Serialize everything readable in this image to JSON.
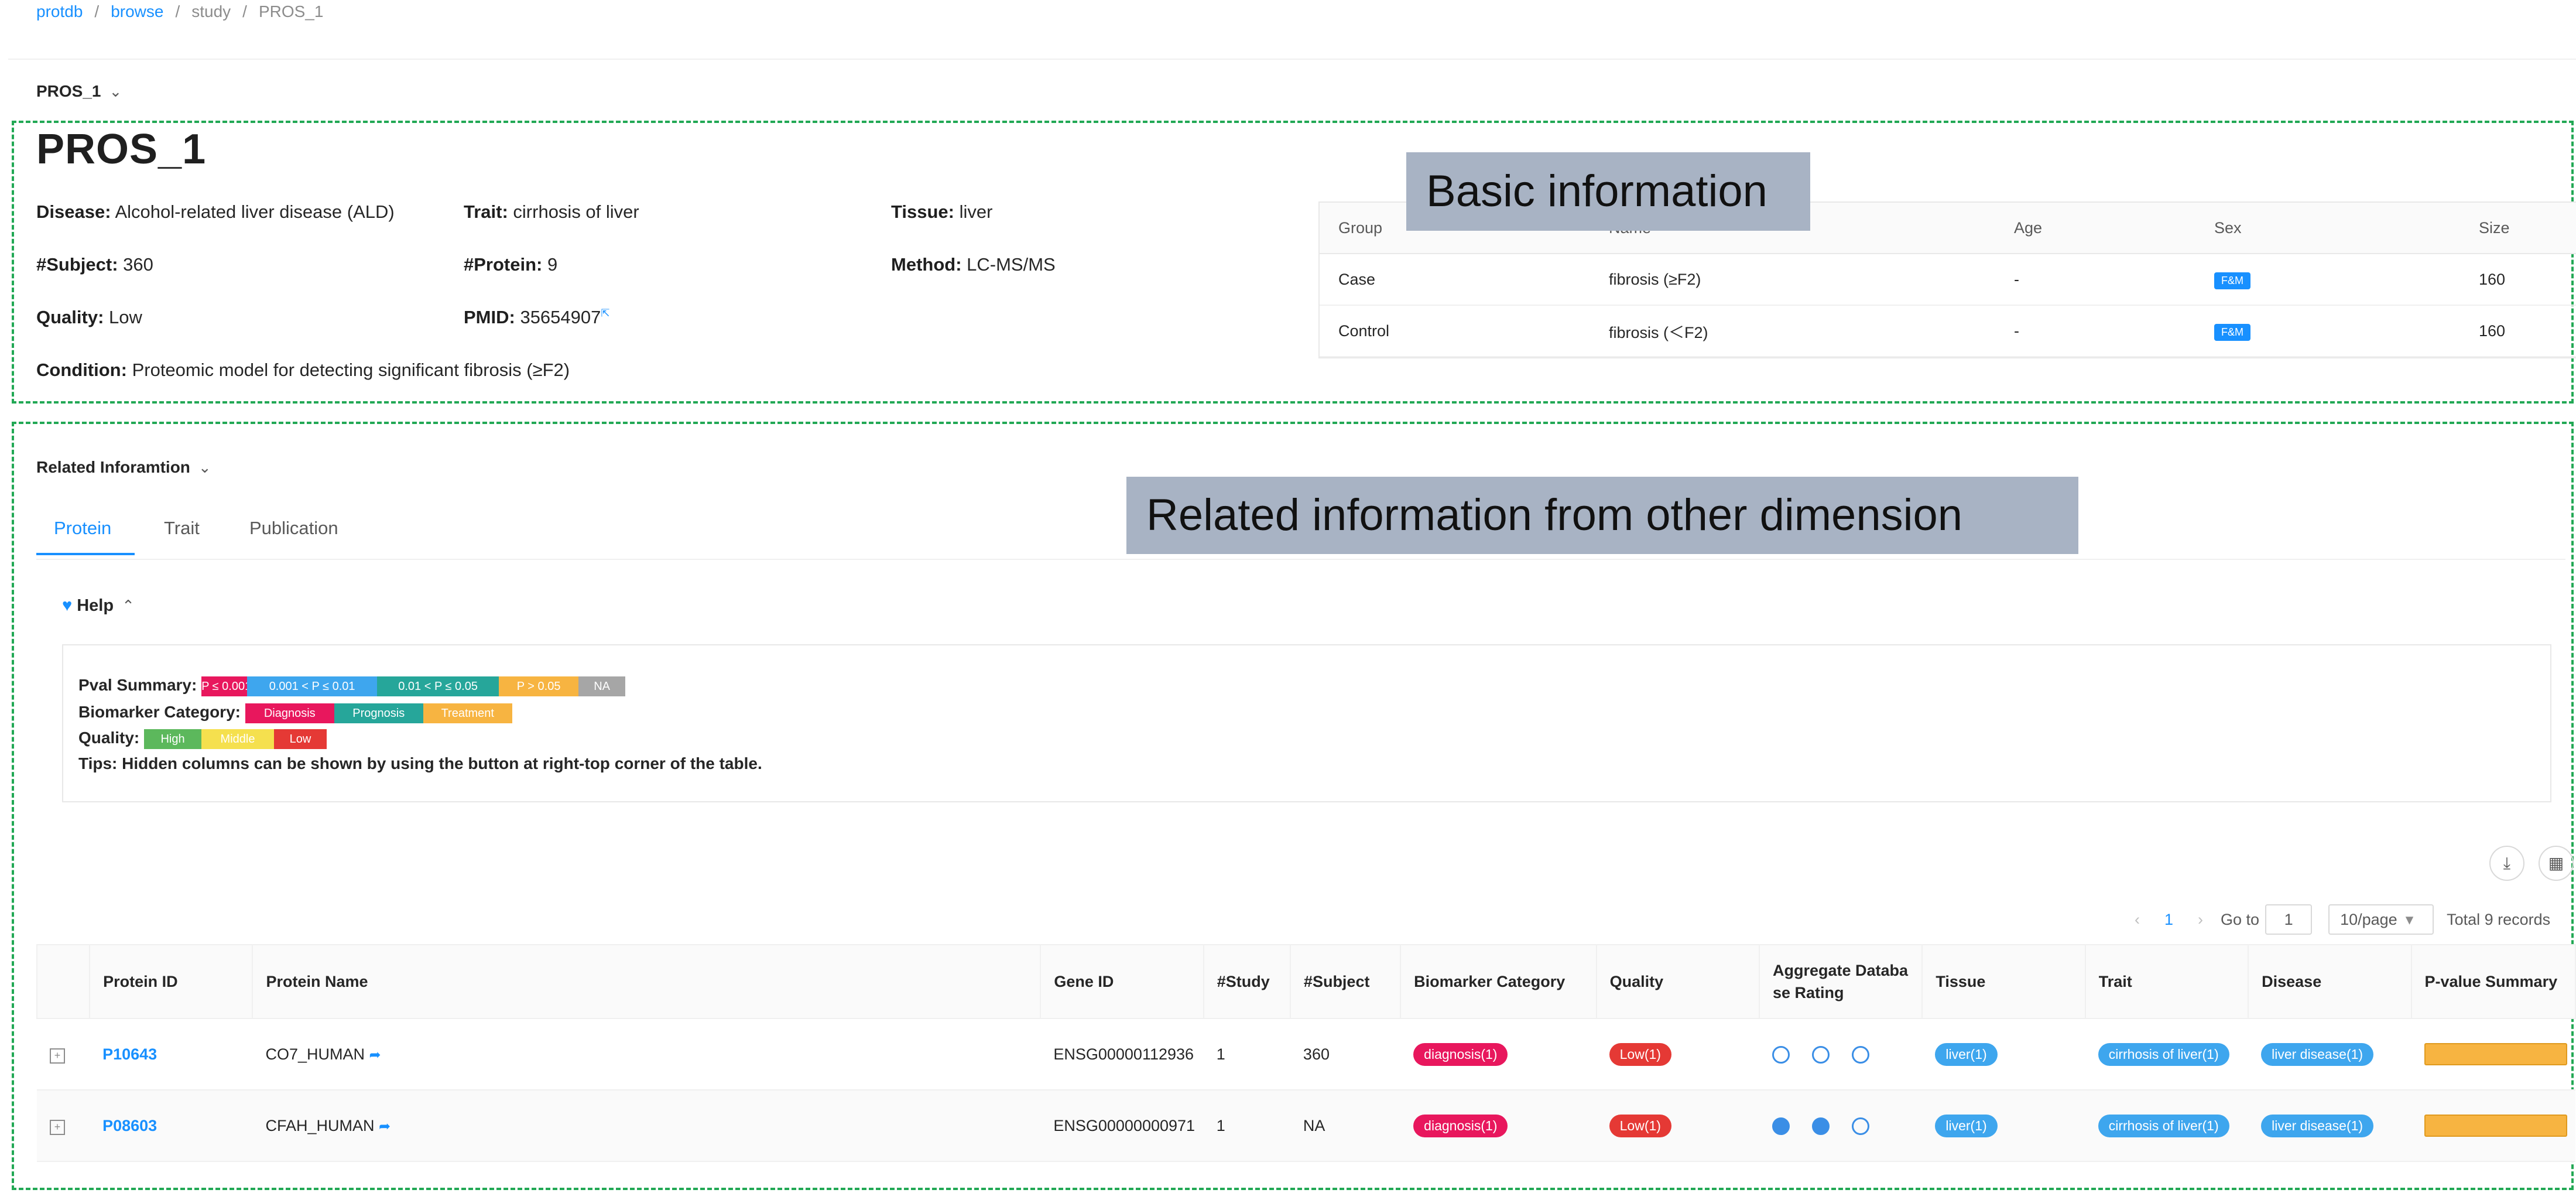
{
  "breadcrumb": [
    "protdb",
    "browse",
    "study",
    "PROS_1"
  ],
  "card_title": "PROS_1",
  "basic": {
    "title": "PROS_1",
    "disease_label": "Disease:",
    "disease": "Alcohol-related liver disease (ALD)",
    "trait_label": "Trait:",
    "trait": "cirrhosis of liver",
    "tissue_label": "Tissue:",
    "tissue": "liver",
    "subject_label": "#Subject:",
    "subject": "360",
    "protein_label": "#Protein:",
    "protein": "9",
    "method_label": "Method:",
    "method": "LC-MS/MS",
    "quality_label": "Quality:",
    "quality": "Low",
    "pmid_label": "PMID:",
    "pmid": "35654907",
    "condition_label": "Condition:",
    "condition": "Proteomic model for detecting significant fibrosis (≥F2)"
  },
  "annotations": {
    "basic": "Basic information",
    "related": "Related information from other dimension"
  },
  "group_table": {
    "headers": [
      "Group",
      "Name",
      "Age",
      "Sex",
      "Size"
    ],
    "rows": [
      {
        "group": "Case",
        "name": "fibrosis (≥F2)",
        "age": "-",
        "sex": "F&M",
        "size": "160"
      },
      {
        "group": "Control",
        "name": "fibrosis (＜F2)",
        "age": "-",
        "sex": "F&M",
        "size": "160"
      }
    ]
  },
  "related": {
    "heading": "Related Inforamtion",
    "tabs": [
      "Protein",
      "Trait",
      "Publication"
    ]
  },
  "help": {
    "title": "Help",
    "pval_label": "Pval Summary:",
    "pval_chips": [
      "P ≤ 0.001",
      "0.001 < P ≤ 0.01",
      "0.01 < P ≤ 0.05",
      "P > 0.05",
      "NA"
    ],
    "bio_label": "Biomarker Category:",
    "bio_chips": [
      "Diagnosis",
      "Prognosis",
      "Treatment"
    ],
    "quality_label": "Quality:",
    "quality_chips": [
      "High",
      "Middle",
      "Low"
    ],
    "tips": "Tips: Hidden columns can be shown by using the button at right-top corner of the table."
  },
  "colors": {
    "pval": [
      "#e8175d",
      "#3ea6ee",
      "#26a69a",
      "#f7b441",
      "#a6a6a6"
    ],
    "bio": [
      "#e8175d",
      "#26a69a",
      "#f7b441"
    ],
    "quality": [
      "#5cb85c",
      "#f5e04e",
      "#e53935"
    ]
  },
  "pager": {
    "page": "1",
    "goto_label": "Go to",
    "goto_value": "1",
    "page_size": "10/page",
    "total": "Total 9 records"
  },
  "protein_table": {
    "headers": [
      "",
      "Protein ID",
      "Protein Name",
      "Gene ID",
      "#Study",
      "#Subject",
      "Biomarker Category",
      "Quality",
      "Aggregate Database Rating",
      "Tissue",
      "Trait",
      "Disease",
      "P-value Summary"
    ],
    "rows": [
      {
        "id": "P10643",
        "name": "CO7_HUMAN",
        "gene": "ENSG00000112936",
        "study": "1",
        "subject": "360",
        "bio": "diagnosis(1)",
        "quality": "Low(1)",
        "rating": [
          false,
          false,
          false
        ],
        "tissue": "liver(1)",
        "trait": "cirrhosis of liver(1)",
        "disease": "liver disease(1)"
      },
      {
        "id": "P08603",
        "name": "CFAH_HUMAN",
        "gene": "ENSG00000000971",
        "study": "1",
        "subject": "NA",
        "bio": "diagnosis(1)",
        "quality": "Low(1)",
        "rating": [
          true,
          true,
          false
        ],
        "tissue": "liver(1)",
        "trait": "cirrhosis of liver(1)",
        "disease": "liver disease(1)"
      }
    ]
  }
}
